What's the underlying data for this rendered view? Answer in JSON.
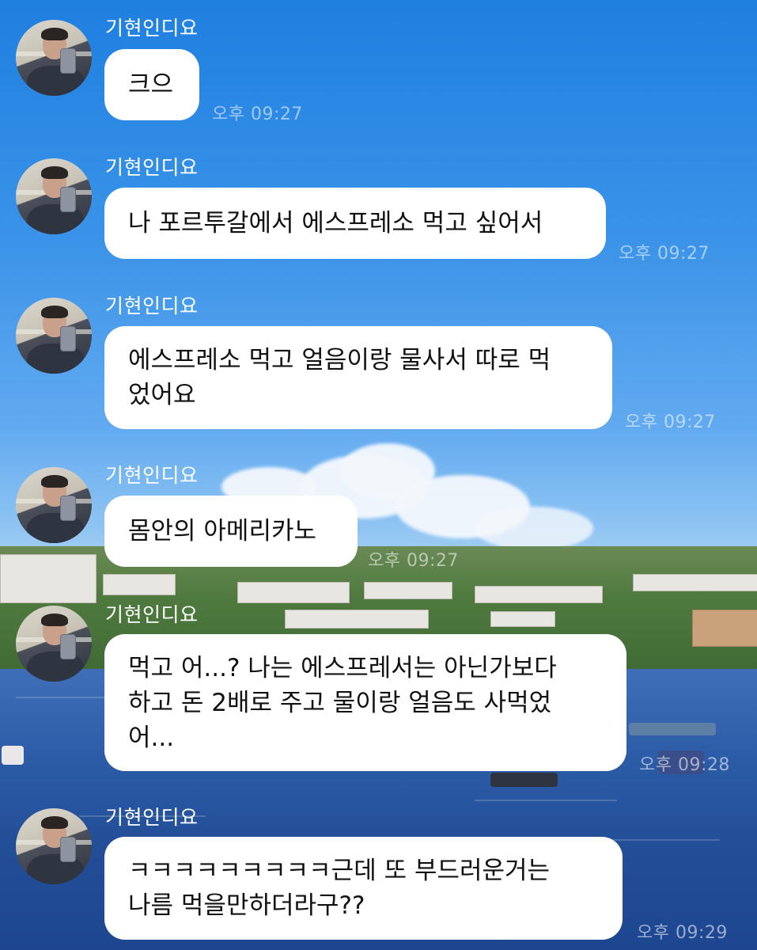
{
  "chat": {
    "messages": [
      {
        "sender": "기현인디요",
        "text": "크으",
        "time": "오후 09:27"
      },
      {
        "sender": "기현인디요",
        "text": "나 포르투갈에서 에스프레소 먹고 싶어서",
        "time": "오후 09:27"
      },
      {
        "sender": "기현인디요",
        "text_lines": [
          "에스프레소 먹고 얼음이랑 물사서 따로 먹",
          "었어요"
        ],
        "time": "오후 09:27"
      },
      {
        "sender": "기현인디요",
        "text": "몸안의 아메리카노",
        "time": "오후 09:27"
      },
      {
        "sender": "기현인디요",
        "text_lines": [
          "먹고 어...? 나는 에스프레서는 아닌가보다",
          "하고 돈 2배로 주고 물이랑 얼음도 사먹었",
          "어..."
        ],
        "time": "오후 09:28"
      },
      {
        "sender": "기현인디요",
        "text_lines": [
          "ㅋㅋㅋㅋㅋㅋㅋㅋㅋ근데 또 부드러운거는",
          "나름 먹을만하더라구??"
        ],
        "time": "오후 09:29"
      }
    ]
  },
  "icons": {
    "avatar": "profile-photo-avatar"
  },
  "colors": {
    "bubble": "#ffffff",
    "sender_name": "#ffffff",
    "time": "rgba(255,255,255,0.55)",
    "sky": "#2a86e4",
    "sea": "#2d5da8"
  }
}
